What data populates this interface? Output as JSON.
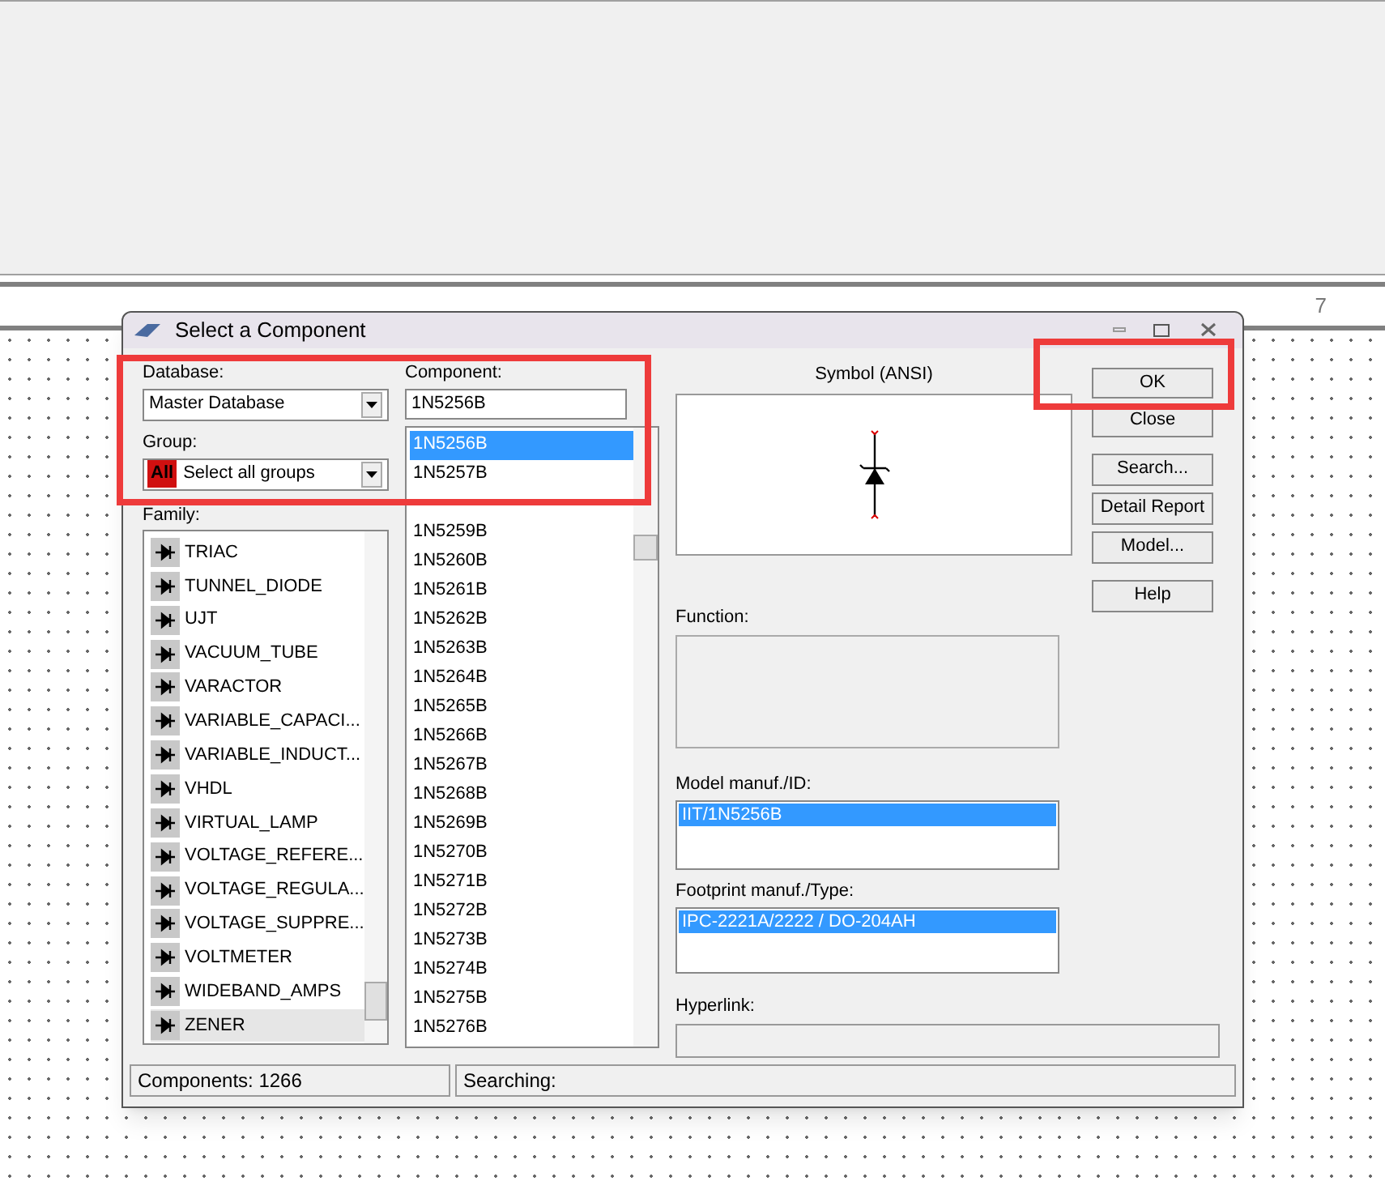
{
  "ruler": {
    "labels": [
      "7"
    ]
  },
  "dialog": {
    "title": "Select a Component",
    "database": {
      "label": "Database:",
      "value": "Master Database"
    },
    "group": {
      "label": "Group:",
      "badge": "All",
      "value": "Select all groups"
    },
    "family": {
      "label": "Family:",
      "items": [
        {
          "name": "TRIAC",
          "selected": false
        },
        {
          "name": "TUNNEL_DIODE",
          "selected": false
        },
        {
          "name": "UJT",
          "selected": false
        },
        {
          "name": "VACUUM_TUBE",
          "selected": false
        },
        {
          "name": "VARACTOR",
          "selected": false
        },
        {
          "name": "VARIABLE_CAPACI...",
          "selected": false
        },
        {
          "name": "VARIABLE_INDUCT...",
          "selected": false
        },
        {
          "name": "VHDL",
          "selected": false
        },
        {
          "name": "VIRTUAL_LAMP",
          "selected": false
        },
        {
          "name": "VOLTAGE_REFERE...",
          "selected": false
        },
        {
          "name": "VOLTAGE_REGULA...",
          "selected": false
        },
        {
          "name": "VOLTAGE_SUPPRE...",
          "selected": false
        },
        {
          "name": "VOLTMETER",
          "selected": false
        },
        {
          "name": "WIDEBAND_AMPS",
          "selected": false
        },
        {
          "name": "ZENER",
          "selected": true
        }
      ]
    },
    "component": {
      "label": "Component:",
      "value": "1N5256B",
      "items": [
        {
          "name": "1N5256B",
          "selected": true
        },
        {
          "name": "1N5257B",
          "selected": false
        },
        {
          "name": "1N5259B",
          "selected": false
        },
        {
          "name": "1N5260B",
          "selected": false
        },
        {
          "name": "1N5261B",
          "selected": false
        },
        {
          "name": "1N5262B",
          "selected": false
        },
        {
          "name": "1N5263B",
          "selected": false
        },
        {
          "name": "1N5264B",
          "selected": false
        },
        {
          "name": "1N5265B",
          "selected": false
        },
        {
          "name": "1N5266B",
          "selected": false
        },
        {
          "name": "1N5267B",
          "selected": false
        },
        {
          "name": "1N5268B",
          "selected": false
        },
        {
          "name": "1N5269B",
          "selected": false
        },
        {
          "name": "1N5270B",
          "selected": false
        },
        {
          "name": "1N5271B",
          "selected": false
        },
        {
          "name": "1N5272B",
          "selected": false
        },
        {
          "name": "1N5273B",
          "selected": false
        },
        {
          "name": "1N5274B",
          "selected": false
        },
        {
          "name": "1N5275B",
          "selected": false
        },
        {
          "name": "1N5276B",
          "selected": false
        }
      ]
    },
    "symbol": {
      "label": "Symbol (ANSI)"
    },
    "function": {
      "label": "Function:"
    },
    "model": {
      "label": "Model manuf./ID:",
      "items": [
        {
          "name": "IIT/1N5256B",
          "selected": true
        }
      ]
    },
    "footprint": {
      "label": "Footprint manuf./Type:",
      "items": [
        {
          "name": "IPC-2221A/2222 / DO-204AH",
          "selected": true
        }
      ]
    },
    "hyperlink": {
      "label": "Hyperlink:"
    },
    "buttons": [
      "OK",
      "Close",
      "Search...",
      "Detail Report",
      "Model...",
      "Help"
    ],
    "status": {
      "components": "Components: 1266",
      "searching": "Searching:"
    }
  }
}
